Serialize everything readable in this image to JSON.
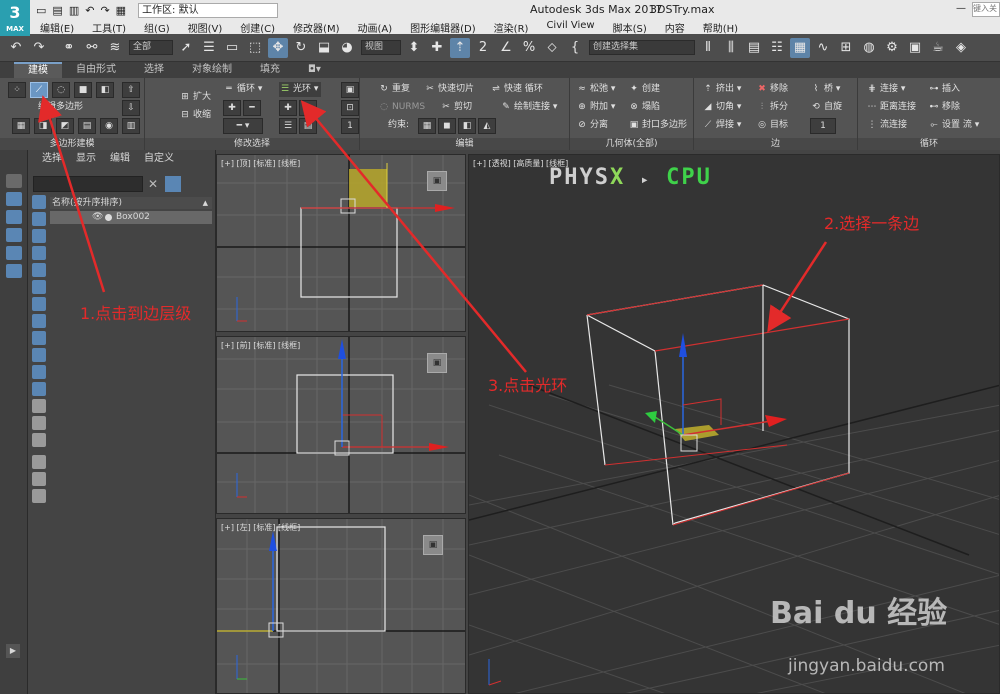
{
  "title_bar": {
    "logo_text": "3",
    "logo_sub": "MAX",
    "workspace": "工作区: 默认",
    "app_title": "Autodesk 3ds Max 2017",
    "file_title": "3DSTry.max",
    "help_search_placeholder": "键入关",
    "minimize": "—"
  },
  "menu": [
    "编辑(E)",
    "工具(T)",
    "组(G)",
    "视图(V)",
    "创建(C)",
    "修改器(M)",
    "动画(A)",
    "图形编辑器(D)",
    "渲染(R)",
    "Civil View",
    "脚本(S)",
    "内容",
    "帮助(H)"
  ],
  "main_toolbar": {
    "filter_dropdown": "全部",
    "coord_dropdown": "视图",
    "selection_set": "创建选择集"
  },
  "ribbon_tabs": [
    {
      "label": "建模",
      "active": true
    },
    {
      "label": "自由形式",
      "active": false
    },
    {
      "label": "选择",
      "active": false
    },
    {
      "label": "对象绘制",
      "active": false
    },
    {
      "label": "填充",
      "active": false
    }
  ],
  "ribbon": {
    "poly_modeling": {
      "title": "多边形建模",
      "edit_poly": "编辑多边形"
    },
    "modify_selection": {
      "title": "修改选择",
      "grow": "扩大",
      "shrink": "收缩",
      "loop": "循环",
      "ring": "光环"
    },
    "edit": {
      "title": "编辑",
      "repeat": "重复",
      "quickslice": "快速切片",
      "swiftloop": "快速 循环",
      "nurms": "NURMS",
      "cut": "剪切",
      "paintconnect": "绘制连接",
      "constraints": "约束:"
    },
    "geometry": {
      "title": "几何体(全部)",
      "relax": "松弛",
      "create": "创建",
      "attach": "附加",
      "collapse": "塌陷",
      "detach": "分离",
      "cap_poly": "封口多边形"
    },
    "edges": {
      "title": "边",
      "extrude": "挤出",
      "remove": "移除",
      "bridge": "桥",
      "chamfer": "切角",
      "split": "拆分",
      "spin": "自旋",
      "weld": "焊接",
      "target": "目标",
      "value": "1"
    },
    "loops": {
      "title": "循环",
      "connect": "连接",
      "insert": "插入",
      "distance_connect": "距离连接",
      "remove": "移除",
      "flow_connect": "流连接",
      "set_flow": "设置 流"
    }
  },
  "explorer": {
    "menu": [
      "选择",
      "显示",
      "编辑",
      "自定义"
    ],
    "column_header": "名称(按升序排序)",
    "sort_arrow": "▲",
    "objects": [
      {
        "name": "Box002"
      }
    ]
  },
  "viewports": {
    "top": {
      "label": "[+] [顶] [标准] [线框]"
    },
    "front": {
      "label": "[+] [前] [标准] [线框]"
    },
    "left": {
      "label": "[+] [左] [标准] [线框]"
    },
    "perspective": {
      "label": "[+] [透视] [高质量] [线框]",
      "physx_a": "PHYS",
      "physx_x": "X",
      "physx_arrow": "▸",
      "physx_cpu": "CPU"
    }
  },
  "annotations": {
    "step1": "1.点击到边层级",
    "step2": "2.选择一条边",
    "step3": "3.点击光环"
  },
  "watermark": {
    "brand": "Bai du 经验",
    "url": "jingyan.baidu.com"
  },
  "colors": {
    "annotation": "#e32a2a",
    "selection_blue": "#6b97c4",
    "edge_red": "#d23030"
  }
}
